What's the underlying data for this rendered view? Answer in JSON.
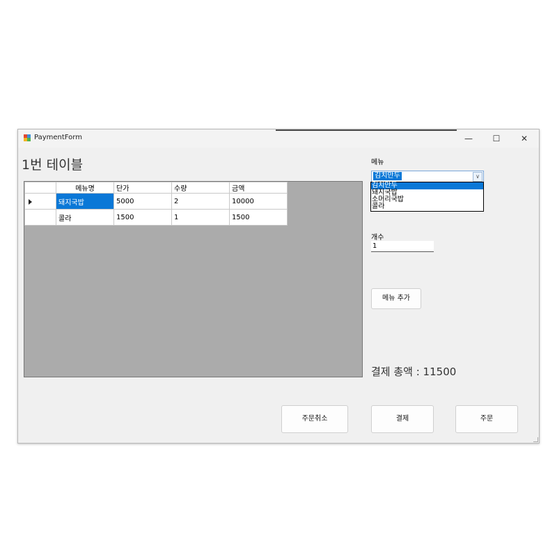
{
  "window": {
    "title": "PaymentForm",
    "minimize_glyph": "—",
    "maximize_glyph": "☐",
    "close_glyph": "✕"
  },
  "table_title": "1번 테이블",
  "grid": {
    "columns": [
      "메뉴명",
      "단가",
      "수량",
      "금액"
    ],
    "rows": [
      {
        "name": "돼지국밥",
        "price": "5000",
        "qty": "2",
        "amount": "10000"
      },
      {
        "name": "콜라",
        "price": "1500",
        "qty": "1",
        "amount": "1500"
      }
    ]
  },
  "menu": {
    "label": "메뉴",
    "selected": "김치만두",
    "options": [
      "김치만두",
      "돼지국밥",
      "소머리국밥",
      "콜라"
    ]
  },
  "count": {
    "label": "개수",
    "value": "1"
  },
  "buttons": {
    "add_menu": "메뉴 추가",
    "cancel_order": "주문취소",
    "pay": "결제",
    "order": "주문"
  },
  "total_text": "결제 총액 : 11500",
  "colors": {
    "selection": "#0a78d7",
    "grid_background": "#ababab",
    "window_background": "#f0f0f0"
  }
}
